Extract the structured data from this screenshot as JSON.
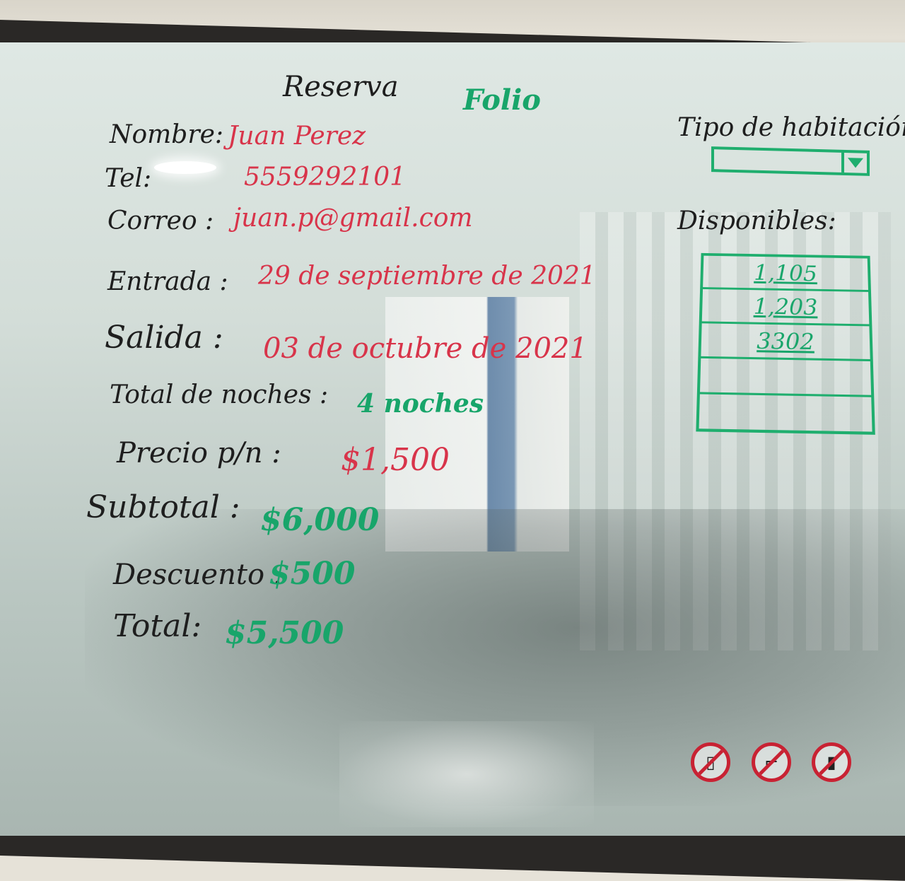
{
  "board": {
    "title": "Reserva",
    "folio": "Folio",
    "fields": {
      "nombre": {
        "label": "Nombre:",
        "value": "Juan Perez"
      },
      "telefono": {
        "label": "Tel:",
        "value": "5559292101"
      },
      "correo": {
        "label": "Correo :",
        "value": "juan.p@gmail.com"
      },
      "entrada": {
        "label": "Entrada :",
        "value": "29 de septiembre de 2021"
      },
      "salida": {
        "label": "Salida :",
        "value": "03 de octubre de 2021"
      },
      "noches": {
        "label": "Total de noches :",
        "value": "4 noches"
      },
      "precio": {
        "label": "Precio p/n :",
        "value": "$1,500"
      },
      "subtotal": {
        "label": "Subtotal :",
        "value": "$6,000"
      },
      "descuento": {
        "label": "Descuento :",
        "value": "$500"
      },
      "total": {
        "label": "Total:",
        "value": "$5,500"
      }
    },
    "room_type": {
      "label": "Tipo de habitación",
      "selected": ""
    },
    "available": {
      "label": "Disponibles:",
      "rooms": [
        "1,105",
        "1,203",
        "3302",
        "",
        ""
      ]
    },
    "signs": [
      "no-phone-icon",
      "no-smoking-icon",
      "no-drinks-icon"
    ],
    "colors": {
      "marker_black": "#1e1e1e",
      "marker_red": "#d8344a",
      "marker_green": "#18a56a",
      "sign_red": "#c82233"
    }
  }
}
